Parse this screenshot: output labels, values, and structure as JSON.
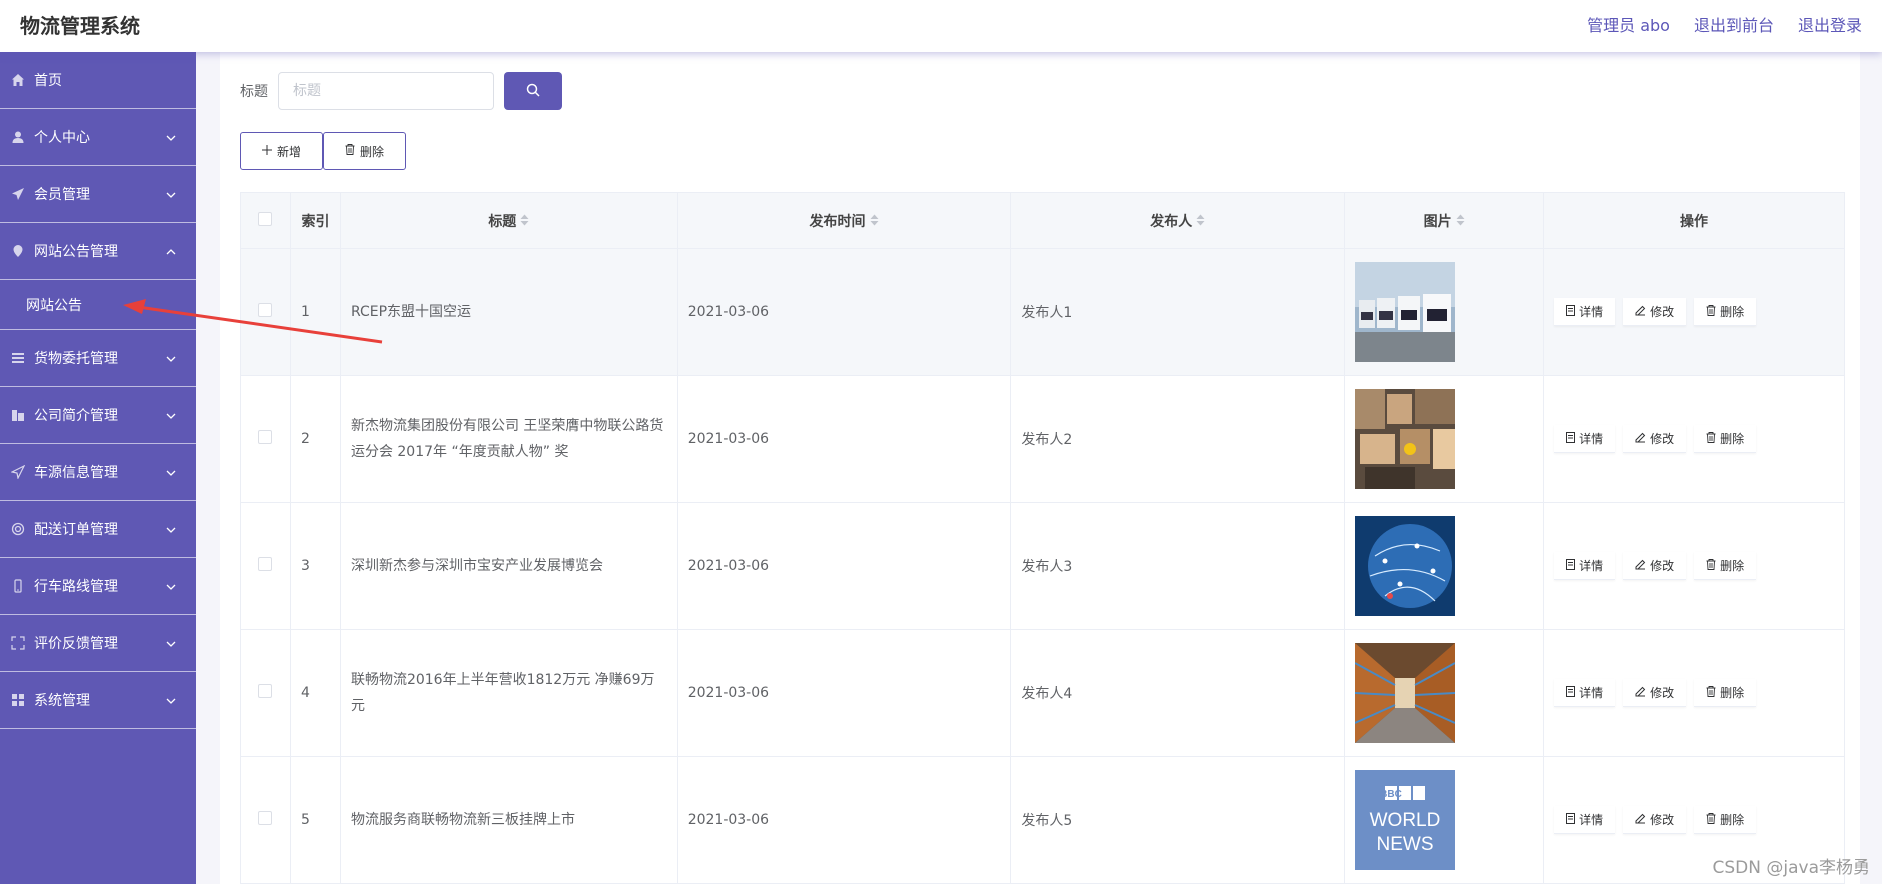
{
  "header": {
    "app_title": "物流管理系统",
    "admin_label": "管理员 abo",
    "front_link": "退出到前台",
    "logout_link": "退出登录"
  },
  "sidebar": {
    "items": [
      {
        "label": "首页",
        "icon": "home-icon",
        "has_chevron": false
      },
      {
        "label": "个人中心",
        "icon": "user-icon",
        "has_chevron": true
      },
      {
        "label": "会员管理",
        "icon": "paper-plane-icon",
        "has_chevron": true
      },
      {
        "label": "网站公告管理",
        "icon": "location-icon",
        "has_chevron": true,
        "expanded": true
      },
      {
        "label": "货物委托管理",
        "icon": "list-icon",
        "has_chevron": true
      },
      {
        "label": "公司简介管理",
        "icon": "building-icon",
        "has_chevron": true
      },
      {
        "label": "车源信息管理",
        "icon": "send-icon",
        "has_chevron": true
      },
      {
        "label": "配送订单管理",
        "icon": "ring-icon",
        "has_chevron": true
      },
      {
        "label": "行车路线管理",
        "icon": "phone-icon",
        "has_chevron": true
      },
      {
        "label": "评价反馈管理",
        "icon": "fullscreen-icon",
        "has_chevron": true
      },
      {
        "label": "系统管理",
        "icon": "grid-icon",
        "has_chevron": true
      }
    ],
    "sub_item": "网站公告"
  },
  "search": {
    "label": "标题",
    "placeholder": "标题"
  },
  "actions": {
    "add_label": "新增",
    "delete_label": "删除"
  },
  "table": {
    "headers": {
      "index": "索引",
      "title": "标题",
      "date": "发布时间",
      "publisher": "发布人",
      "image": "图片",
      "ops": "操作"
    },
    "rows": [
      {
        "index": "1",
        "title": "RCEP东盟十国空运",
        "date": "2021-03-06",
        "publisher": "发布人1",
        "image": "trucks"
      },
      {
        "index": "2",
        "title": "新杰物流集团股份有限公司 王坚荣膺中物联公路货运分会 2017年 “年度贡献人物” 奖",
        "date": "2021-03-06",
        "publisher": "发布人2",
        "image": "warehouse-boxes"
      },
      {
        "index": "3",
        "title": "深圳新杰参与深圳市宝安产业发展博览会",
        "date": "2021-03-06",
        "publisher": "发布人3",
        "image": "global-network"
      },
      {
        "index": "4",
        "title": "联畅物流2016年上半年营收1812万元 净赚69万元",
        "date": "2021-03-06",
        "publisher": "发布人4",
        "image": "warehouse-aisle"
      },
      {
        "index": "5",
        "title": "物流服务商联畅物流新三板挂牌上市",
        "date": "2021-03-06",
        "publisher": "发布人5",
        "image": "bbc-world-news"
      }
    ],
    "op_labels": {
      "detail": "详情",
      "edit": "修改",
      "delete": "删除"
    }
  },
  "bbc_logo": {
    "line1": "BBC",
    "line2": "WORLD",
    "line3": "NEWS"
  },
  "watermark": "CSDN @java李杨勇",
  "colors": {
    "accent": "#5f58b4",
    "arrow": "#e8403a"
  }
}
